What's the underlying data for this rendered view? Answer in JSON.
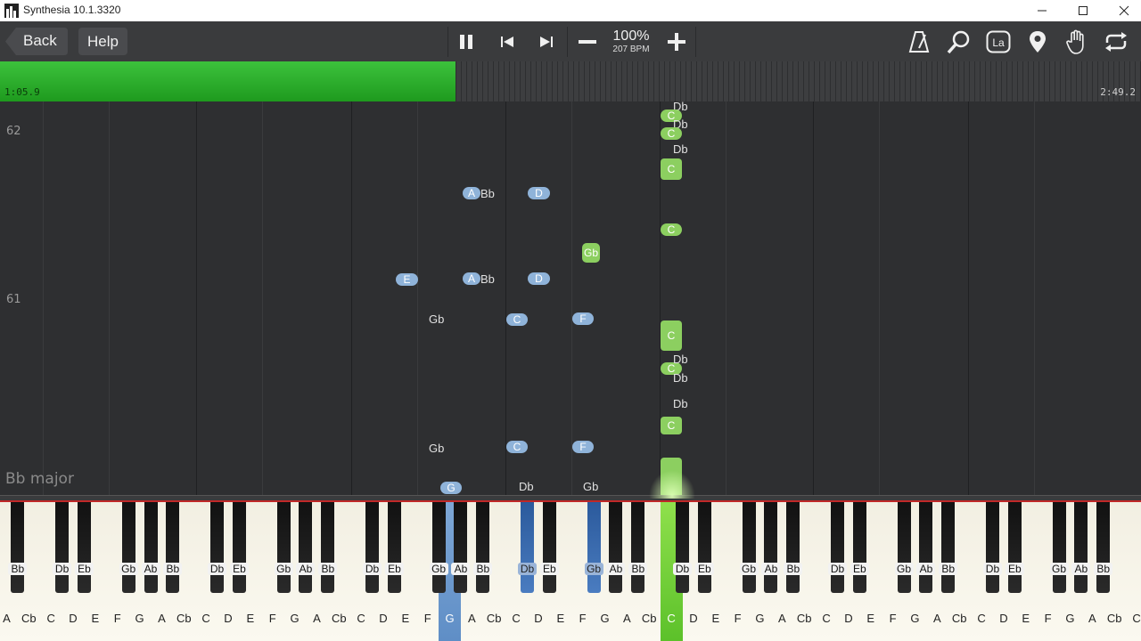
{
  "window": {
    "title": "Synthesia 10.1.3320"
  },
  "toolbar": {
    "back_label": "Back",
    "help_label": "Help",
    "speed_percent": "100%",
    "tempo": "207 BPM"
  },
  "timeline": {
    "elapsed": "1:05.9",
    "total": "2:49.2",
    "progress": 0.399
  },
  "roll": {
    "measure_62": "62",
    "measure_61": "61",
    "key_signature": "Bb major"
  },
  "colors": {
    "left_hand": "#8fb3d9",
    "right_hand": "#8ccf60",
    "played": "#2fb52f"
  },
  "notes": [
    {
      "label": "Db",
      "hand": "right",
      "style": "text"
    },
    {
      "label": "C",
      "hand": "right",
      "style": "pill"
    },
    {
      "label": "Db",
      "hand": "right",
      "style": "text"
    },
    {
      "label": "C",
      "hand": "right",
      "style": "pill"
    },
    {
      "label": "Db",
      "hand": "right",
      "style": "text"
    },
    {
      "label": "C",
      "hand": "right",
      "style": "pill"
    },
    {
      "label": "A",
      "hand": "left",
      "style": "pill"
    },
    {
      "label": "Bb",
      "hand": "left",
      "style": "text"
    },
    {
      "label": "D",
      "hand": "left",
      "style": "pill"
    },
    {
      "label": "C",
      "hand": "right",
      "style": "pill"
    },
    {
      "label": "Gb",
      "hand": "right",
      "style": "pill"
    },
    {
      "label": "E",
      "hand": "left",
      "style": "pill"
    },
    {
      "label": "A",
      "hand": "left",
      "style": "pill"
    },
    {
      "label": "Bb",
      "hand": "left",
      "style": "text"
    },
    {
      "label": "D",
      "hand": "left",
      "style": "pill"
    },
    {
      "label": "Gb",
      "hand": "left",
      "style": "text"
    },
    {
      "label": "C",
      "hand": "left",
      "style": "pill"
    },
    {
      "label": "F",
      "hand": "left",
      "style": "pill"
    },
    {
      "label": "C",
      "hand": "right",
      "style": "pill"
    },
    {
      "label": "C",
      "hand": "right",
      "style": "pill"
    },
    {
      "label": "Db",
      "hand": "right",
      "style": "text"
    },
    {
      "label": "Db",
      "hand": "right",
      "style": "text"
    },
    {
      "label": "Db",
      "hand": "right",
      "style": "text"
    },
    {
      "label": "C",
      "hand": "right",
      "style": "pill"
    },
    {
      "label": "Gb",
      "hand": "left",
      "style": "text"
    },
    {
      "label": "C",
      "hand": "left",
      "style": "pill"
    },
    {
      "label": "F",
      "hand": "left",
      "style": "pill"
    },
    {
      "label": "G",
      "hand": "left",
      "style": "pill"
    },
    {
      "label": "Db",
      "hand": "left",
      "style": "text"
    },
    {
      "label": "Gb",
      "hand": "left",
      "style": "text"
    }
  ],
  "keyboard": {
    "white_keys": [
      "A",
      "Cb",
      "C",
      "D",
      "E",
      "F",
      "G",
      "A",
      "Cb",
      "C",
      "D",
      "E",
      "F",
      "G",
      "A",
      "Cb",
      "C",
      "D",
      "E",
      "F",
      "G",
      "A",
      "Cb",
      "C",
      "D",
      "E",
      "F",
      "G",
      "A",
      "Cb",
      "C",
      "D",
      "E",
      "F",
      "G",
      "A",
      "Cb",
      "C",
      "D",
      "E",
      "F",
      "G",
      "A",
      "Cb",
      "C",
      "D",
      "E",
      "F",
      "G",
      "A",
      "Cb",
      "C"
    ],
    "black_keys": [
      "Bb",
      "Db",
      "Eb",
      "Gb",
      "Ab",
      "Bb",
      "Db",
      "Eb",
      "Gb",
      "Ab",
      "Bb",
      "Db",
      "Eb",
      "Gb",
      "Ab",
      "Bb",
      "Db",
      "Eb",
      "Gb",
      "Ab",
      "Bb",
      "Db",
      "Eb",
      "Gb",
      "Ab",
      "Bb",
      "Db",
      "Eb",
      "Gb",
      "Ab",
      "Bb",
      "Db",
      "Eb",
      "Gb",
      "Ab",
      "Bb"
    ],
    "pressed_white": [
      {
        "index": 20,
        "hand": "left"
      },
      {
        "index": 30,
        "hand": "right"
      }
    ],
    "pressed_black": [
      {
        "index": 16,
        "hand": "left"
      },
      {
        "index": 18,
        "hand": "left"
      }
    ]
  }
}
